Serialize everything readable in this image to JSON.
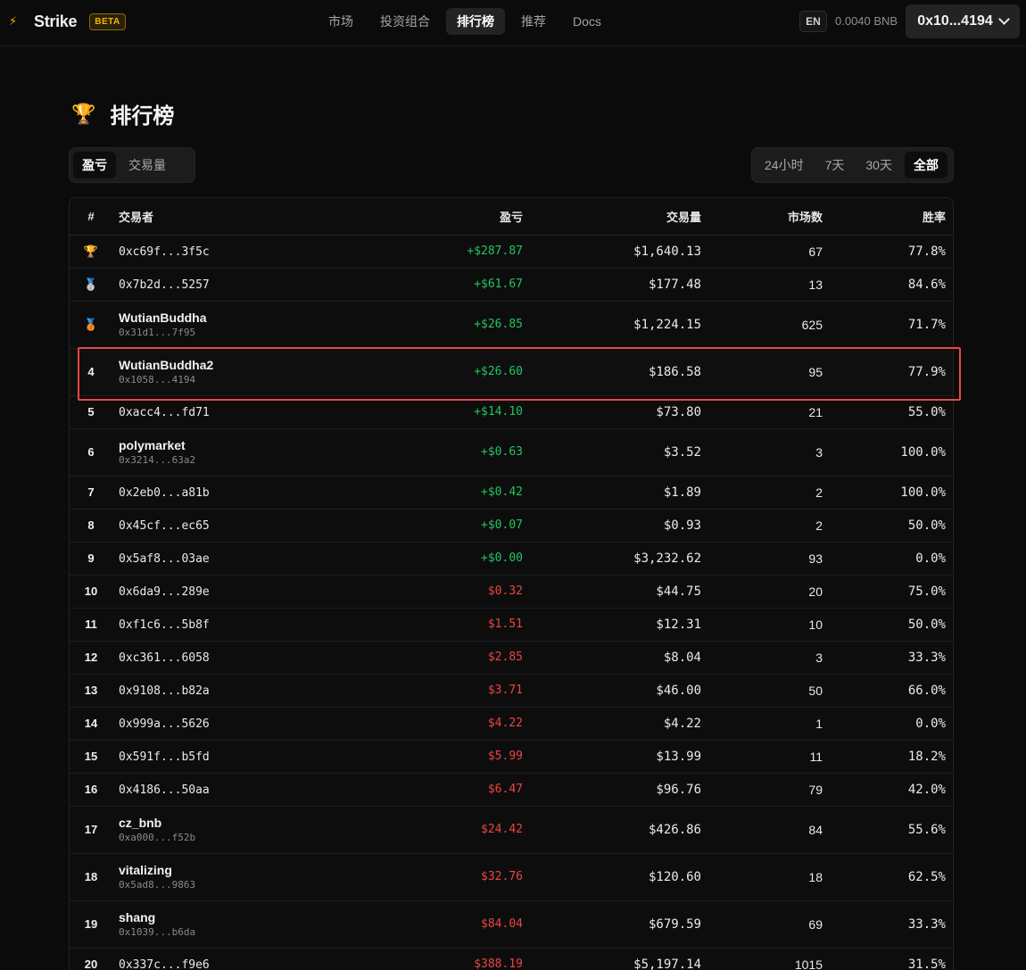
{
  "app": {
    "bolt_icon": "⚡",
    "brand": "Strike",
    "badge": "BETA"
  },
  "nav": {
    "items": [
      "市场",
      "投资组合",
      "排行榜",
      "推荐",
      "Docs"
    ],
    "active": "排行榜"
  },
  "header": {
    "lang": "EN",
    "balance": "0.0040 BNB",
    "wallet": "0x10...4194"
  },
  "page": {
    "title_icon": "🏆",
    "title": "排行榜"
  },
  "metric_tabs": {
    "items": [
      "盈亏",
      "交易量"
    ],
    "active": "盈亏"
  },
  "range_tabs": {
    "items": [
      "24小时",
      "7天",
      "30天",
      "全部"
    ],
    "active": "全部"
  },
  "table": {
    "columns": [
      "#",
      "交易者",
      "盈亏",
      "交易量",
      "市场数",
      "胜率"
    ],
    "rows": [
      {
        "rank": "🏆",
        "medal": true,
        "name": "",
        "addr": "0xc69f...3f5c",
        "pnl": "+$287.87",
        "sign": "pos",
        "volume": "$1,640.13",
        "markets": "67",
        "win": "77.8%"
      },
      {
        "rank": "🥈",
        "medal": true,
        "name": "",
        "addr": "0x7b2d...5257",
        "pnl": "+$61.67",
        "sign": "pos",
        "volume": "$177.48",
        "markets": "13",
        "win": "84.6%"
      },
      {
        "rank": "🥉",
        "medal": true,
        "name": "WutianBuddha",
        "addr": "0x31d1...7f95",
        "pnl": "+$26.85",
        "sign": "pos",
        "volume": "$1,224.15",
        "markets": "625",
        "win": "71.7%"
      },
      {
        "rank": "4",
        "medal": false,
        "name": "WutianBuddha2",
        "addr": "0x1058...4194",
        "pnl": "+$26.60",
        "sign": "pos",
        "volume": "$186.58",
        "markets": "95",
        "win": "77.9%",
        "highlight": true
      },
      {
        "rank": "5",
        "medal": false,
        "name": "",
        "addr": "0xacc4...fd71",
        "pnl": "+$14.10",
        "sign": "pos",
        "volume": "$73.80",
        "markets": "21",
        "win": "55.0%"
      },
      {
        "rank": "6",
        "medal": false,
        "name": "polymarket",
        "addr": "0x3214...63a2",
        "pnl": "+$0.63",
        "sign": "pos",
        "volume": "$3.52",
        "markets": "3",
        "win": "100.0%"
      },
      {
        "rank": "7",
        "medal": false,
        "name": "",
        "addr": "0x2eb0...a81b",
        "pnl": "+$0.42",
        "sign": "pos",
        "volume": "$1.89",
        "markets": "2",
        "win": "100.0%"
      },
      {
        "rank": "8",
        "medal": false,
        "name": "",
        "addr": "0x45cf...ec65",
        "pnl": "+$0.07",
        "sign": "pos",
        "volume": "$0.93",
        "markets": "2",
        "win": "50.0%"
      },
      {
        "rank": "9",
        "medal": false,
        "name": "",
        "addr": "0x5af8...03ae",
        "pnl": "+$0.00",
        "sign": "pos",
        "volume": "$3,232.62",
        "markets": "93",
        "win": "0.0%"
      },
      {
        "rank": "10",
        "medal": false,
        "name": "",
        "addr": "0x6da9...289e",
        "pnl": "$0.32",
        "sign": "neg",
        "volume": "$44.75",
        "markets": "20",
        "win": "75.0%"
      },
      {
        "rank": "11",
        "medal": false,
        "name": "",
        "addr": "0xf1c6...5b8f",
        "pnl": "$1.51",
        "sign": "neg",
        "volume": "$12.31",
        "markets": "10",
        "win": "50.0%"
      },
      {
        "rank": "12",
        "medal": false,
        "name": "",
        "addr": "0xc361...6058",
        "pnl": "$2.85",
        "sign": "neg",
        "volume": "$8.04",
        "markets": "3",
        "win": "33.3%"
      },
      {
        "rank": "13",
        "medal": false,
        "name": "",
        "addr": "0x9108...b82a",
        "pnl": "$3.71",
        "sign": "neg",
        "volume": "$46.00",
        "markets": "50",
        "win": "66.0%"
      },
      {
        "rank": "14",
        "medal": false,
        "name": "",
        "addr": "0x999a...5626",
        "pnl": "$4.22",
        "sign": "neg",
        "volume": "$4.22",
        "markets": "1",
        "win": "0.0%"
      },
      {
        "rank": "15",
        "medal": false,
        "name": "",
        "addr": "0x591f...b5fd",
        "pnl": "$5.99",
        "sign": "neg",
        "volume": "$13.99",
        "markets": "11",
        "win": "18.2%"
      },
      {
        "rank": "16",
        "medal": false,
        "name": "",
        "addr": "0x4186...50aa",
        "pnl": "$6.47",
        "sign": "neg",
        "volume": "$96.76",
        "markets": "79",
        "win": "42.0%"
      },
      {
        "rank": "17",
        "medal": false,
        "name": "cz_bnb",
        "addr": "0xa000...f52b",
        "pnl": "$24.42",
        "sign": "neg",
        "volume": "$426.86",
        "markets": "84",
        "win": "55.6%"
      },
      {
        "rank": "18",
        "medal": false,
        "name": "vitalizing",
        "addr": "0x5ad8...9863",
        "pnl": "$32.76",
        "sign": "neg",
        "volume": "$120.60",
        "markets": "18",
        "win": "62.5%"
      },
      {
        "rank": "19",
        "medal": false,
        "name": "shang",
        "addr": "0x1039...b6da",
        "pnl": "$84.04",
        "sign": "neg",
        "volume": "$679.59",
        "markets": "69",
        "win": "33.3%"
      },
      {
        "rank": "20",
        "medal": false,
        "name": "",
        "addr": "0x337c...f9e6",
        "pnl": "$388.19",
        "sign": "neg",
        "volume": "$5,197.14",
        "markets": "1015",
        "win": "31.5%"
      }
    ]
  },
  "colors": {
    "positive": "#22c55e",
    "negative": "#ef4444",
    "accent": "#f5b400",
    "highlight_border": "#e74848"
  }
}
